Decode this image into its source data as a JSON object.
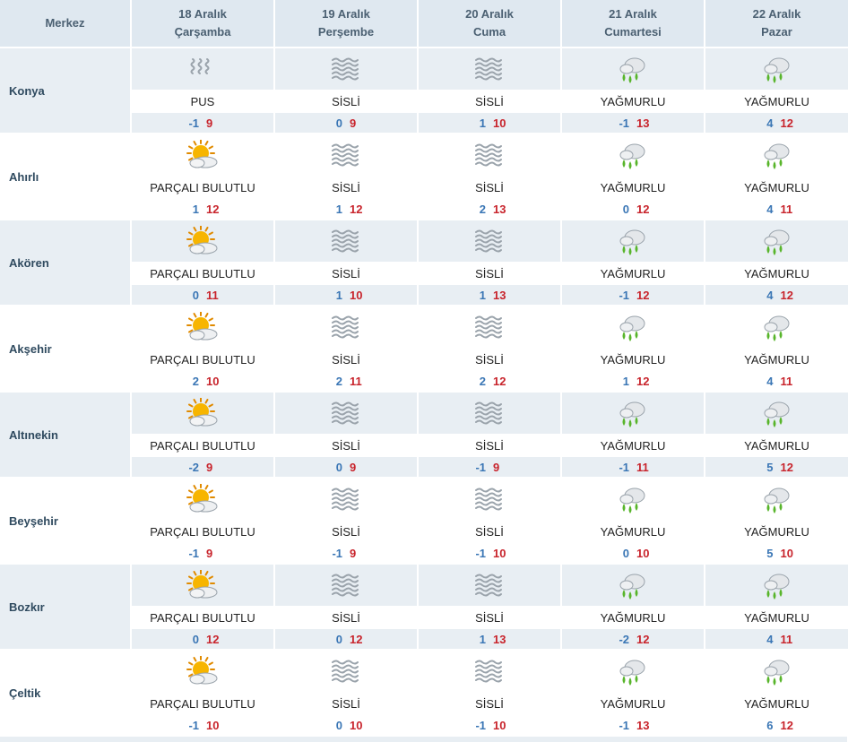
{
  "header": {
    "center_label": "Merkez",
    "days": [
      {
        "date": "18 Aralık",
        "weekday": "Çarşamba"
      },
      {
        "date": "19 Aralık",
        "weekday": "Perşembe"
      },
      {
        "date": "20 Aralık",
        "weekday": "Cuma"
      },
      {
        "date": "21 Aralık",
        "weekday": "Cumartesi"
      },
      {
        "date": "22 Aralık",
        "weekday": "Pazar"
      }
    ]
  },
  "icon_names": {
    "PUS": "haze-icon",
    "SİSLİ": "fog-icon",
    "YAĞMURLU": "rain-icon",
    "PARÇALI BULUTLU": "partly-cloudy-icon"
  },
  "colors": {
    "header_bg": "#dfe8f0",
    "row_shade": "#e8eef3",
    "min_temp": "#3a76b5",
    "max_temp": "#c8242c"
  },
  "cities": [
    {
      "name": "Konya",
      "days": [
        {
          "cond": "PUS",
          "min": "-1",
          "max": "9"
        },
        {
          "cond": "SİSLİ",
          "min": "0",
          "max": "9"
        },
        {
          "cond": "SİSLİ",
          "min": "1",
          "max": "10"
        },
        {
          "cond": "YAĞMURLU",
          "min": "-1",
          "max": "13"
        },
        {
          "cond": "YAĞMURLU",
          "min": "4",
          "max": "12"
        }
      ]
    },
    {
      "name": "Ahırlı",
      "days": [
        {
          "cond": "PARÇALI BULUTLU",
          "min": "1",
          "max": "12"
        },
        {
          "cond": "SİSLİ",
          "min": "1",
          "max": "12"
        },
        {
          "cond": "SİSLİ",
          "min": "2",
          "max": "13"
        },
        {
          "cond": "YAĞMURLU",
          "min": "0",
          "max": "12"
        },
        {
          "cond": "YAĞMURLU",
          "min": "4",
          "max": "11"
        }
      ]
    },
    {
      "name": "Akören",
      "days": [
        {
          "cond": "PARÇALI BULUTLU",
          "min": "0",
          "max": "11"
        },
        {
          "cond": "SİSLİ",
          "min": "1",
          "max": "10"
        },
        {
          "cond": "SİSLİ",
          "min": "1",
          "max": "13"
        },
        {
          "cond": "YAĞMURLU",
          "min": "-1",
          "max": "12"
        },
        {
          "cond": "YAĞMURLU",
          "min": "4",
          "max": "12"
        }
      ]
    },
    {
      "name": "Akşehir",
      "days": [
        {
          "cond": "PARÇALI BULUTLU",
          "min": "2",
          "max": "10"
        },
        {
          "cond": "SİSLİ",
          "min": "2",
          "max": "11"
        },
        {
          "cond": "SİSLİ",
          "min": "2",
          "max": "12"
        },
        {
          "cond": "YAĞMURLU",
          "min": "1",
          "max": "12"
        },
        {
          "cond": "YAĞMURLU",
          "min": "4",
          "max": "11"
        }
      ]
    },
    {
      "name": "Altınekin",
      "days": [
        {
          "cond": "PARÇALI BULUTLU",
          "min": "-2",
          "max": "9"
        },
        {
          "cond": "SİSLİ",
          "min": "0",
          "max": "9"
        },
        {
          "cond": "SİSLİ",
          "min": "-1",
          "max": "9"
        },
        {
          "cond": "YAĞMURLU",
          "min": "-1",
          "max": "11"
        },
        {
          "cond": "YAĞMURLU",
          "min": "5",
          "max": "12"
        }
      ]
    },
    {
      "name": "Beyşehir",
      "days": [
        {
          "cond": "PARÇALI BULUTLU",
          "min": "-1",
          "max": "9"
        },
        {
          "cond": "SİSLİ",
          "min": "-1",
          "max": "9"
        },
        {
          "cond": "SİSLİ",
          "min": "-1",
          "max": "10"
        },
        {
          "cond": "YAĞMURLU",
          "min": "0",
          "max": "10"
        },
        {
          "cond": "YAĞMURLU",
          "min": "5",
          "max": "10"
        }
      ]
    },
    {
      "name": "Bozkır",
      "days": [
        {
          "cond": "PARÇALI BULUTLU",
          "min": "0",
          "max": "12"
        },
        {
          "cond": "SİSLİ",
          "min": "0",
          "max": "12"
        },
        {
          "cond": "SİSLİ",
          "min": "1",
          "max": "13"
        },
        {
          "cond": "YAĞMURLU",
          "min": "-2",
          "max": "12"
        },
        {
          "cond": "YAĞMURLU",
          "min": "4",
          "max": "11"
        }
      ]
    },
    {
      "name": "Çeltik",
      "days": [
        {
          "cond": "PARÇALI BULUTLU",
          "min": "-1",
          "max": "10"
        },
        {
          "cond": "SİSLİ",
          "min": "0",
          "max": "10"
        },
        {
          "cond": "SİSLİ",
          "min": "-1",
          "max": "10"
        },
        {
          "cond": "YAĞMURLU",
          "min": "-1",
          "max": "13"
        },
        {
          "cond": "YAĞMURLU",
          "min": "6",
          "max": "12"
        }
      ]
    }
  ]
}
